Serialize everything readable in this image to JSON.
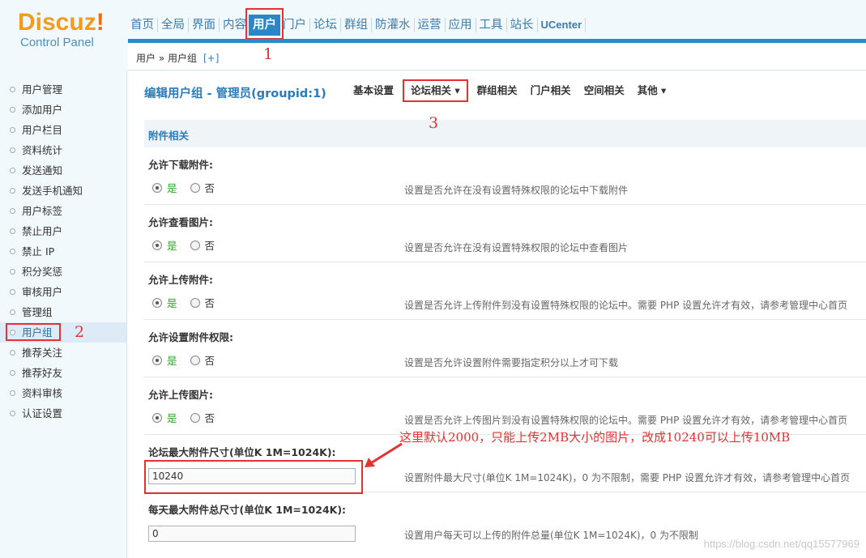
{
  "logo": {
    "brand": "Discuz",
    "brand_mark": "!",
    "subtitle": "Control Panel"
  },
  "topnav": {
    "items": [
      "首页",
      "全局",
      "界面",
      "内容",
      "用户",
      "门户",
      "论坛",
      "群组",
      "防灌水",
      "运营",
      "应用",
      "工具",
      "站长",
      "UCenter"
    ],
    "active": "用户"
  },
  "breadcrumb": {
    "path": "用户 » 用户组",
    "add": "[+]"
  },
  "sidebar": {
    "items": [
      {
        "label": "用户管理"
      },
      {
        "label": "添加用户"
      },
      {
        "label": "用户栏目"
      },
      {
        "label": "资料统计"
      },
      {
        "label": "发送通知"
      },
      {
        "label": "发送手机通知"
      },
      {
        "label": "用户标签"
      },
      {
        "label": "禁止用户"
      },
      {
        "label": "禁止 IP"
      },
      {
        "label": "积分奖惩"
      },
      {
        "label": "审核用户"
      },
      {
        "label": "管理组"
      },
      {
        "label": "用户组"
      },
      {
        "label": "推荐关注"
      },
      {
        "label": "推荐好友"
      },
      {
        "label": "资料审核"
      },
      {
        "label": "认证设置"
      }
    ],
    "active": "用户组"
  },
  "main": {
    "title": "编辑用户组 - 管理员(groupid:1)",
    "tabs": [
      "基本设置",
      "论坛相关 ▾",
      "群组相关",
      "门户相关",
      "空间相关",
      "其他 ▾"
    ],
    "active_tab": "论坛相关",
    "section": "附件相关",
    "rows": [
      {
        "label": "允许下载附件:",
        "yes": "是",
        "no": "否",
        "value": "是",
        "desc": "设置是否允许在没有设置特殊权限的论坛中下载附件"
      },
      {
        "label": "允许查看图片:",
        "yes": "是",
        "no": "否",
        "value": "是",
        "desc": "设置是否允许在没有设置特殊权限的论坛中查看图片"
      },
      {
        "label": "允许上传附件:",
        "yes": "是",
        "no": "否",
        "value": "是",
        "desc": "设置是否允许上传附件到没有设置特殊权限的论坛中。需要 PHP 设置允许才有效，请参考管理中心首页"
      },
      {
        "label": "允许设置附件权限:",
        "yes": "是",
        "no": "否",
        "value": "是",
        "desc": "设置是否允许设置附件需要指定积分以上才可下载"
      },
      {
        "label": "允许上传图片:",
        "yes": "是",
        "no": "否",
        "value": "是",
        "desc": "设置是否允许上传图片到没有设置特殊权限的论坛中。需要 PHP 设置允许才有效，请参考管理中心首页"
      }
    ],
    "inputs": [
      {
        "label": "论坛最大附件尺寸(单位K 1M=1024K):",
        "value": "10240",
        "desc": "设置附件最大尺寸(单位K 1M=1024K)，0 为不限制，需要 PHP 设置允许才有效，请参考管理中心首页"
      },
      {
        "label": "每天最大附件总尺寸(单位K 1M=1024K):",
        "value": "0",
        "desc": "设置用户每天可以上传的附件总量(单位K 1M=1024K)，0 为不限制"
      }
    ]
  },
  "annotations": {
    "step1": "1",
    "step2": "2",
    "step3": "3",
    "note": "这里默认2000，只能上传2MB大小的图片，改成10240可以上传10MB",
    "color": "#e23232"
  },
  "watermark": "https://blog.csdn.net/qq15577969"
}
